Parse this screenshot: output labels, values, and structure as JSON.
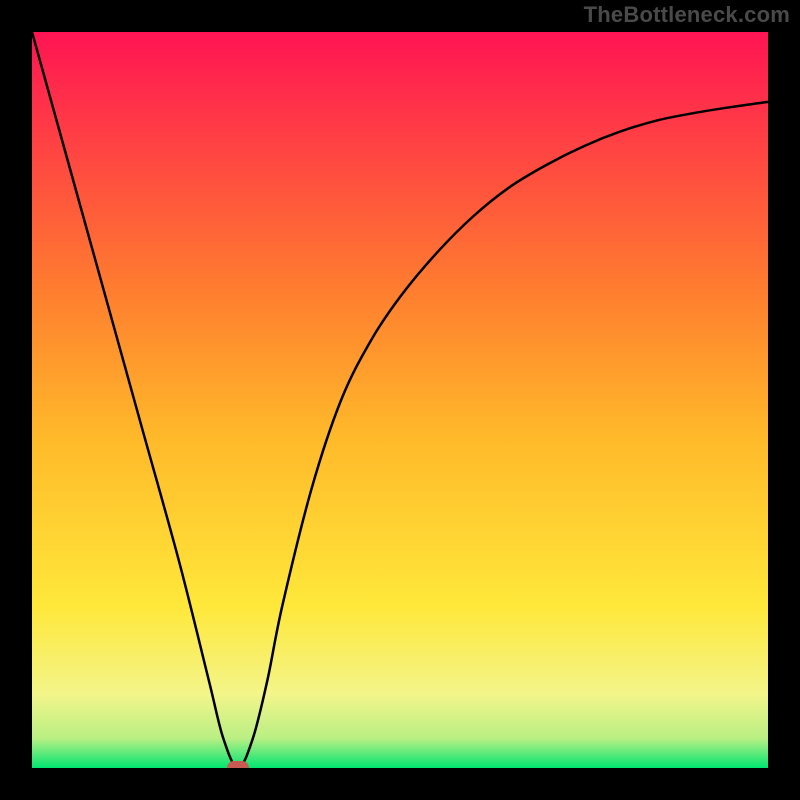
{
  "watermark": "TheBottleneck.com",
  "chart_data": {
    "type": "line",
    "title": "",
    "xlabel": "",
    "ylabel": "",
    "xlim": [
      0,
      100
    ],
    "ylim": [
      0,
      100
    ],
    "grid": false,
    "legend": false,
    "background_gradient": {
      "top_color": "#ff1453",
      "bottom_color": "#00e571",
      "stops": [
        {
          "offset": 0.0,
          "color": "#ff1453"
        },
        {
          "offset": 0.35,
          "color": "#ff7d2f"
        },
        {
          "offset": 0.55,
          "color": "#ffb92a"
        },
        {
          "offset": 0.78,
          "color": "#ffe83a"
        },
        {
          "offset": 0.9,
          "color": "#f3f58a"
        },
        {
          "offset": 0.96,
          "color": "#b9ef84"
        },
        {
          "offset": 1.0,
          "color": "#00e571"
        }
      ]
    },
    "series": [
      {
        "name": "bottleneck-curve",
        "color": "#000000",
        "x": [
          0,
          5,
          10,
          15,
          20,
          24,
          26,
          28,
          30,
          32,
          34,
          38,
          42,
          46,
          50,
          55,
          60,
          65,
          70,
          75,
          80,
          85,
          90,
          95,
          100
        ],
        "y": [
          100,
          82,
          64,
          46,
          28,
          12,
          4,
          0,
          4,
          12,
          22,
          38,
          50,
          58,
          64,
          70,
          75,
          79,
          82,
          84.5,
          86.5,
          88,
          89,
          89.8,
          90.5
        ]
      }
    ],
    "marker": {
      "name": "optimum-marker",
      "x": 28,
      "y": 0,
      "color": "#c85a54"
    }
  }
}
